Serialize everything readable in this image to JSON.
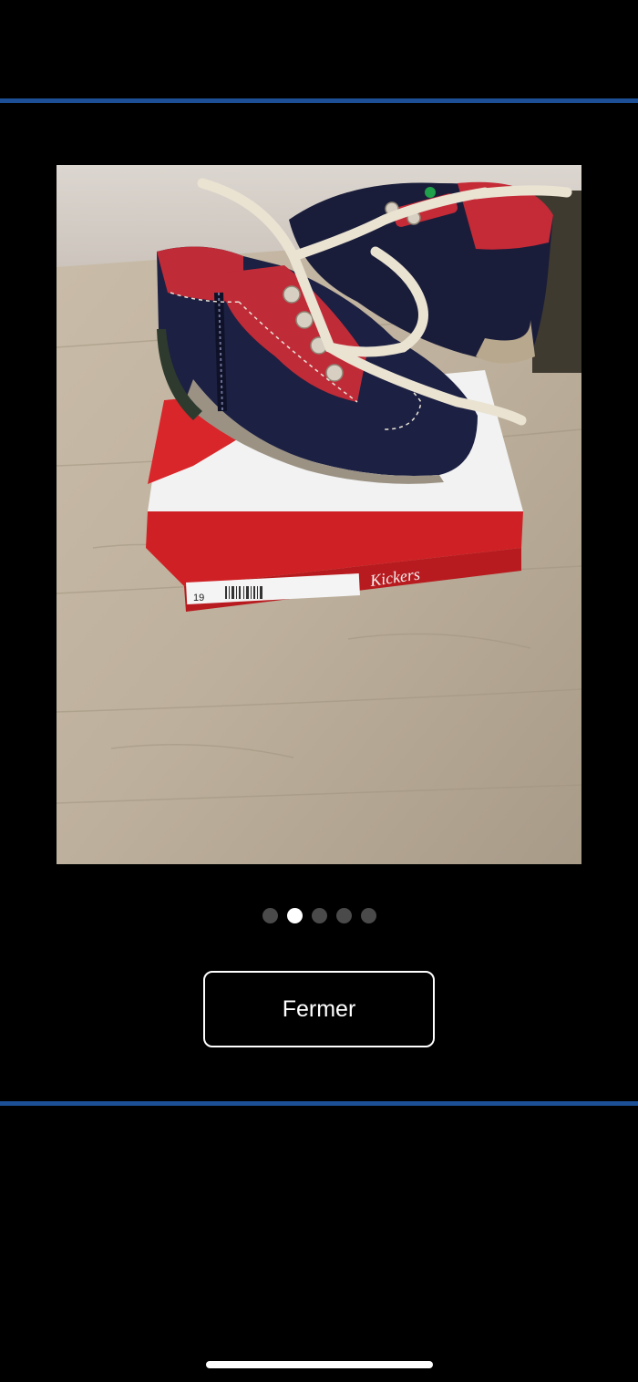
{
  "gallery": {
    "photo_alt": "Chaussures bébé Kickers sur leur boîte",
    "box_brand_text": "Kickers",
    "box_label_size": "19",
    "pagination": {
      "total": 5,
      "active_index": 1
    }
  },
  "actions": {
    "close_label": "Fermer"
  },
  "colors": {
    "background": "#000000",
    "divider": "#1c4f96",
    "dot_active": "#ffffff",
    "dot_inactive": "#4a4a4a"
  }
}
